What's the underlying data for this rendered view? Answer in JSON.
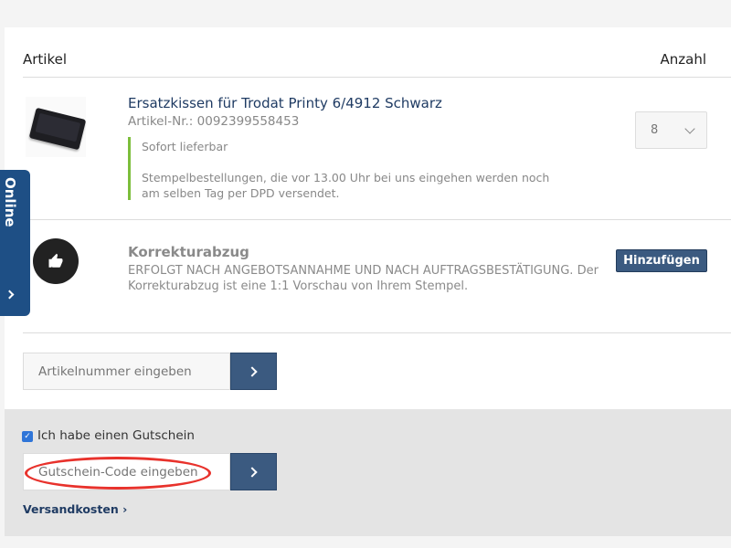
{
  "header": {
    "article_label": "Artikel",
    "quantity_label": "Anzahl"
  },
  "product": {
    "title": "Ersatzkissen für Trodat Printy 6/4912 Schwarz",
    "sku": "Artikel-Nr.: 0092399558453",
    "availability": "Sofort lieferbar",
    "shipping_note": "Stempelbestellungen, die vor 13.00 Uhr bei uns eingehen werden noch am selben Tag per DPD versendet.",
    "quantity": "8"
  },
  "proof": {
    "title": "Korrekturabzug",
    "description": "ERFOLGT NACH ANGEBOTSANNAHME UND NACH AUFTRAGSBESTÄTIGUNG. Der Korrekturabzug ist eine 1:1 Vorschau von Ihrem Stempel.",
    "add_label": "Hinzufügen",
    "icon": "thumbs-up-icon"
  },
  "article_input": {
    "placeholder": "Artikelnummer eingeben"
  },
  "voucher": {
    "checkbox_label": "Ich habe einen Gutschein",
    "checked": true,
    "placeholder": "Gutschein-Code eingeben"
  },
  "shipping_link": "Versandkosten ›",
  "side_tab": {
    "label": "Online"
  },
  "colors": {
    "accent": "#3b5a80",
    "title": "#1f3b63",
    "availability": "#7cbe3b",
    "highlight": "#e8322c",
    "tab": "#1e4f85"
  }
}
